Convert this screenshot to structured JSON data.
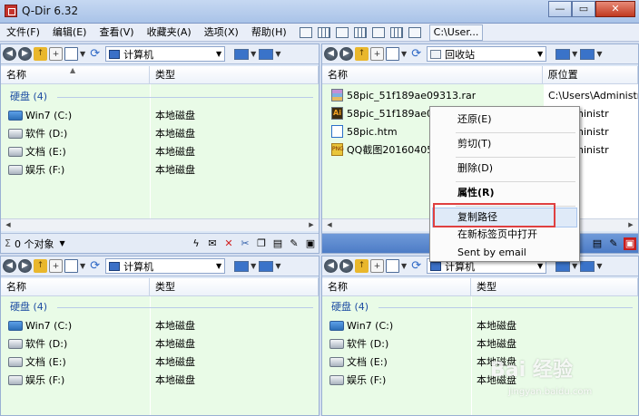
{
  "window": {
    "title": "Q-Dir 6.32",
    "minimize": "—",
    "maximize": "▭",
    "close": "✕"
  },
  "menu": {
    "items": [
      "文件(F)",
      "编辑(E)",
      "查看(V)",
      "收藏夹(A)",
      "选项(X)",
      "帮助(H)"
    ],
    "path": "C:\\User..."
  },
  "panes": {
    "tl": {
      "address": "计算机",
      "headers": [
        "名称",
        "类型"
      ],
      "group": "硬盘 (4)",
      "rows": [
        {
          "name": "Win7 (C:)",
          "type": "本地磁盘"
        },
        {
          "name": "软件 (D:)",
          "type": "本地磁盘"
        },
        {
          "name": "文档 (E:)",
          "type": "本地磁盘"
        },
        {
          "name": "娱乐 (F:)",
          "type": "本地磁盘"
        }
      ],
      "status": "0 个对象"
    },
    "tr": {
      "address": "回收站",
      "headers": [
        "名称",
        "原位置"
      ],
      "rows": [
        {
          "name": "58pic_51f189ae09313.rar",
          "orig": "C:\\Users\\Administr"
        },
        {
          "name": "58pic_51f189ae06",
          "orig": "rs\\Administr"
        },
        {
          "name": "58pic.htm",
          "orig": "rs\\Administr"
        },
        {
          "name": "QQ截图20160405",
          "orig": "rs\\Administr"
        }
      ]
    },
    "bl": {
      "address": "计算机",
      "headers": [
        "名称",
        "类型"
      ],
      "group": "硬盘 (4)",
      "rows": [
        {
          "name": "Win7 (C:)",
          "type": "本地磁盘"
        },
        {
          "name": "软件 (D:)",
          "type": "本地磁盘"
        },
        {
          "name": "文档 (E:)",
          "type": "本地磁盘"
        },
        {
          "name": "娱乐 (F:)",
          "type": "本地磁盘"
        }
      ]
    },
    "br": {
      "address": "计算机",
      "headers": [
        "名称",
        "类型"
      ],
      "group": "硬盘 (4)",
      "rows": [
        {
          "name": "Win7 (C:)",
          "type": "本地磁盘"
        },
        {
          "name": "软件 (D:)",
          "type": "本地磁盘"
        },
        {
          "name": "文档 (E:)",
          "type": "本地磁盘"
        },
        {
          "name": "娱乐 (F:)",
          "type": "本地磁盘"
        }
      ]
    }
  },
  "context_menu": {
    "restore": "还原(E)",
    "cut": "剪切(T)",
    "delete": "删除(D)",
    "properties": "属性(R)",
    "copy_path": "复制路径",
    "open_new_tab": "在新标签页中打开",
    "send_email": "Sent by email"
  },
  "watermark": {
    "brand": "Bai 经验",
    "url": "jingyan.baidu.com"
  }
}
